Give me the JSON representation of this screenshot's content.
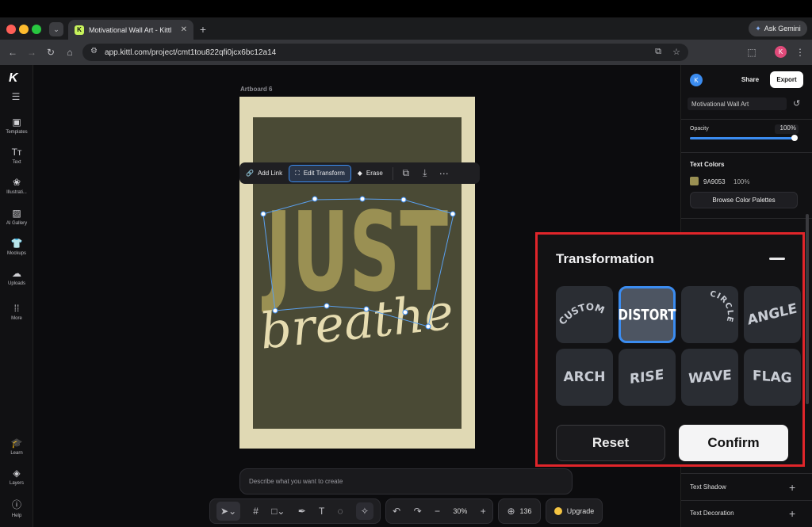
{
  "browser": {
    "tab_title": "Motivational Wall Art - Kittl",
    "url": "app.kittl.com/project/cmt1tou822qfi0jcx6bc12a14",
    "ask_gemini": "Ask Gemini",
    "profile_initial": "K"
  },
  "sidebar": {
    "logo": "K",
    "items": [
      {
        "label": "Templates"
      },
      {
        "label": "Text"
      },
      {
        "label": "Illustrati..."
      },
      {
        "label": "AI Gallery"
      },
      {
        "label": "Mockups"
      },
      {
        "label": "Uploads"
      },
      {
        "label": "More"
      }
    ],
    "bottom_items": [
      {
        "label": "Learn"
      },
      {
        "label": "Layers"
      },
      {
        "label": "Help"
      }
    ]
  },
  "canvas": {
    "artboard_label": "Artboard 6",
    "art_text_main": "JUST",
    "art_text_script": "breathe",
    "context_menu": {
      "add_link": "Add Link",
      "edit_transform": "Edit Transform",
      "erase": "Erase"
    },
    "prompt_placeholder": "Describe what you want to create"
  },
  "right_panel": {
    "avatar_initial": "K",
    "share": "Share",
    "export": "Export",
    "project_name": "Motivational Wall Art",
    "opacity_label": "Opacity",
    "opacity_value": "100%",
    "opacity_fraction": 1.0,
    "text_colors_label": "Text Colors",
    "color_hex": "9A9053",
    "color_swatch": "#9a9053",
    "color_opacity": "100%",
    "browse_palettes": "Browse Color Palettes",
    "text_shadow": "Text Shadow",
    "text_decoration": "Text Decoration"
  },
  "transformation": {
    "title": "Transformation",
    "options": [
      {
        "label": "CUSTOM",
        "selected": false
      },
      {
        "label": "DISTORT",
        "selected": true
      },
      {
        "label": "CIRCLE",
        "selected": false
      },
      {
        "label": "ANGLE",
        "selected": false
      },
      {
        "label": "ARCH",
        "selected": false
      },
      {
        "label": "RISE",
        "selected": false
      },
      {
        "label": "WAVE",
        "selected": false
      },
      {
        "label": "FLAG",
        "selected": false
      }
    ],
    "reset": "Reset",
    "confirm": "Confirm"
  },
  "toolbar": {
    "zoom": "30%",
    "credits": "136",
    "upgrade": "Upgrade"
  },
  "colors": {
    "accent_blue": "#3b8cf0",
    "highlight_red": "#e0252a",
    "artboard_bg": "#e0d9b4",
    "artboard_inner": "#4a4a35"
  }
}
